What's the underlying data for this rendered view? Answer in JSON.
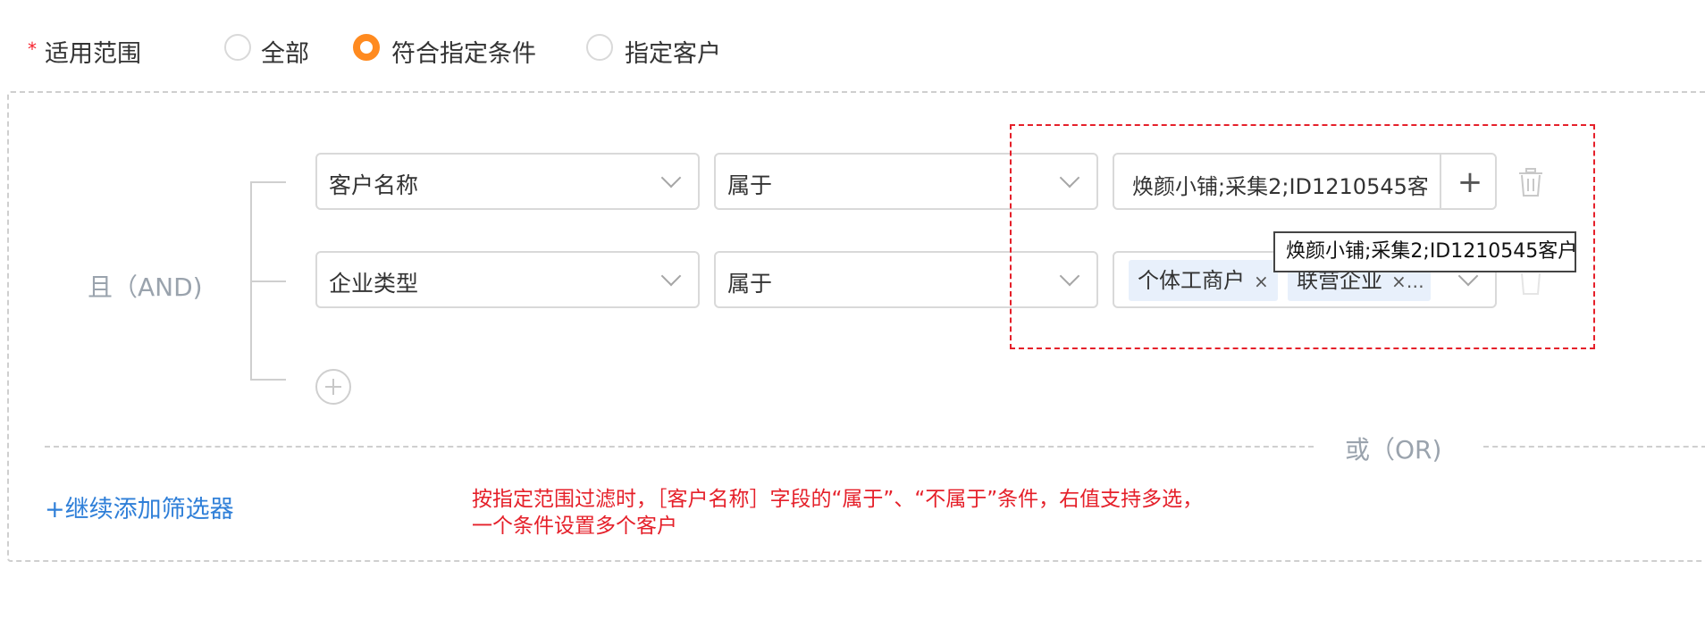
{
  "scope": {
    "required_mark": "*",
    "label": "适用范围",
    "options": [
      {
        "label": "全部",
        "checked": false
      },
      {
        "label": "符合指定条件",
        "checked": true
      },
      {
        "label": "指定客户",
        "checked": false
      }
    ]
  },
  "group": {
    "logic_label": "且（AND)",
    "rows": [
      {
        "field": "客户名称",
        "operator": "属于",
        "value": "焕颜小铺;采集2;ID1210545客户",
        "value_plus": "+"
      },
      {
        "field": "企业类型",
        "operator": "属于",
        "tags": [
          {
            "label": "个体工商户",
            "close": "×"
          },
          {
            "label": "联营企业",
            "close": "×…"
          }
        ]
      }
    ]
  },
  "tooltip": "焕颜小铺;采集2;ID1210545客户",
  "or_label": "或（OR)",
  "add_filter_label": "+继续添加筛选器",
  "note_lines": [
    "按指定范围过滤时，［客户名称］字段的“属于”、“不属于”条件，右值支持多选，",
    "一个条件设置多个客户"
  ],
  "colors": {
    "accent_orange": "#ff8a1f",
    "link_blue": "#2f7fd8",
    "annotation_red": "#e5202a",
    "tag_bg": "#e8f0fb"
  },
  "icons": {
    "chevron": "chevron-down-icon",
    "trash": "trash-icon",
    "plus": "plus-icon",
    "add_circle": "add-circle-icon"
  }
}
